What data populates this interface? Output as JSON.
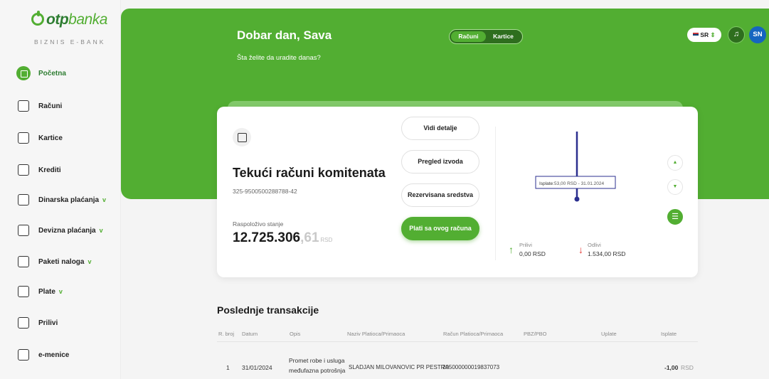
{
  "brand": {
    "name_otp": "otp",
    "name_banka": "banka",
    "tagline": "BIZNIS E-BANK"
  },
  "sidebar": {
    "items": [
      {
        "label": "Početna",
        "icon": "home-dashboard-icon",
        "active": true
      },
      {
        "label": "Računi",
        "icon": "account-icon"
      },
      {
        "label": "Kartice",
        "icon": "card-icon"
      },
      {
        "label": "Krediti",
        "icon": "loan-icon"
      },
      {
        "label": "Dinarska plaćanja",
        "icon": "dinar-payment-icon",
        "chevron": "v"
      },
      {
        "label": "Devizna plaćanja",
        "icon": "foreign-payment-icon",
        "chevron": "v"
      },
      {
        "label": "Paketi naloga",
        "icon": "order-package-icon",
        "chevron": "v"
      },
      {
        "label": "Plate",
        "icon": "salary-icon",
        "chevron": "v"
      },
      {
        "label": "Prilivi",
        "icon": "inflow-icon"
      },
      {
        "label": "e-menice",
        "icon": "e-bill-icon"
      }
    ]
  },
  "header": {
    "greeting": "Dobar dan, Sava",
    "subtitle": "Šta želite da uradite danas?",
    "toggle": {
      "left": "Računi",
      "right": "Kartice"
    },
    "language": "SR",
    "avatar": "SN"
  },
  "account_card": {
    "title": "Tekući računi komitenata",
    "number": "325-9500500288788-42",
    "balance_label": "Raspoloživo stanje",
    "balance_int": "12.725.306",
    "balance_dec": ",61",
    "balance_cur": "RSD",
    "buttons": {
      "details": "Vidi detalje",
      "statements": "Pregled izvoda",
      "reserved": "Rezervisana sredstva",
      "pay": "Plati sa ovog računa"
    },
    "chart_tooltip_label": "Isplate:",
    "chart_tooltip_value": "53,00 RSD - 31.01.2024",
    "inflow_label": "Prilivi",
    "inflow_value": "0,00 RSD",
    "outflow_label": "Odlivi",
    "outflow_value": "1.534,00 RSD"
  },
  "transactions": {
    "title": "Poslednje transakcije",
    "columns": [
      "R. broj",
      "Datum",
      "Opis",
      "Naziv Platioca/Primaoca",
      "Račun Platioca/Primaoca",
      "PBZ/PBO",
      "Uplate",
      "Isplate"
    ],
    "rows": [
      {
        "no": "1",
        "date": "31/01/2024",
        "desc_line1": "Promet robe i usluga",
        "desc_line2": "međufazna potrošnja",
        "party": "SLADJAN MILOVANOVIC PR PESTRA",
        "account": "205000000019837073",
        "pbz": "",
        "in": "",
        "out_amount": "-1,00",
        "out_cur": "RSD"
      }
    ]
  },
  "colors": {
    "brand_green": "#52ae32",
    "dark_green": "#2e6e1e",
    "chart_navy": "#2b2f8f",
    "out_red": "#e53935"
  }
}
